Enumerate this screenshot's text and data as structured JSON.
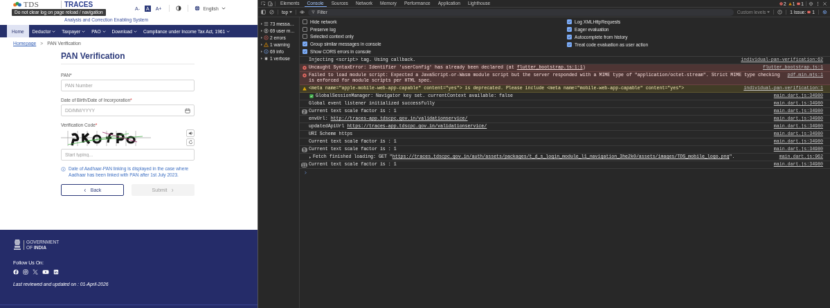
{
  "tooltip": "Do not clear log on page reload / navigation",
  "site": {
    "logo": "TDS",
    "brand": "TRACES",
    "tagline": "Analysis and Correction Enabling System",
    "font_controls": [
      {
        "label": "A-",
        "selected": false
      },
      {
        "label": "A",
        "selected": true
      },
      {
        "label": "A+",
        "selected": false
      }
    ],
    "language": "English"
  },
  "nav": [
    {
      "label": "Home",
      "selected": true,
      "dropdown": false
    },
    {
      "label": "Deductor",
      "selected": false,
      "dropdown": true
    },
    {
      "label": "Taxpayer",
      "selected": false,
      "dropdown": true
    },
    {
      "label": "PAO",
      "selected": false,
      "dropdown": true
    },
    {
      "label": "Download",
      "selected": false,
      "dropdown": true
    },
    {
      "label": "Compliance under Income Tax Act, 1961",
      "selected": false,
      "dropdown": true
    }
  ],
  "breadcrumb": {
    "link": "Homepage",
    "separator": ">",
    "current": "PAN Verification"
  },
  "form": {
    "title": "PAN Verification",
    "fields": [
      {
        "kind": "text",
        "label": "PAN*",
        "placeholder": "PAN Number"
      },
      {
        "kind": "date",
        "label": "Date of Birth/Date of Incorporation",
        "required": "*",
        "placeholder": "DD/MM/YYYY"
      },
      {
        "kind": "captcha",
        "label": "Verification Code",
        "required": "*",
        "placeholder": "Start typing..."
      }
    ],
    "note": "Date of Aadhaar-PAN linking is displayed in the case where Aadhaar has been linked with PAN after 1st July 2023.",
    "buttons": [
      {
        "kind": "back",
        "label": "Back",
        "disabled": false
      },
      {
        "kind": "submit",
        "label": "Submit",
        "disabled": true
      }
    ]
  },
  "footer": {
    "gov_line1": "GOVERNMENT",
    "gov_line2": "OF **INDIA**",
    "follow": "Follow Us  On:",
    "updated": "Last reviewed and updated on : 01-April-2026"
  },
  "devtools": {
    "tabs": [
      {
        "label": "Elements",
        "selected": false
      },
      {
        "label": "Console",
        "selected": true
      },
      {
        "label": "Sources",
        "selected": false
      },
      {
        "label": "Network",
        "selected": false
      },
      {
        "label": "Memory",
        "selected": false
      },
      {
        "label": "Performance",
        "selected": false
      },
      {
        "label": "Application",
        "selected": false
      },
      {
        "label": "Lighthouse",
        "selected": false
      }
    ],
    "counters": [
      {
        "kind": "error",
        "count": "2"
      },
      {
        "kind": "warning",
        "count": "1"
      },
      {
        "kind": "issue",
        "count": "1"
      }
    ],
    "context": "top",
    "filter_placeholder": "Filter",
    "levels": "Custom levels",
    "issues_label": "1 Issue:",
    "issues_count": "1",
    "sidebar": [
      {
        "kind": "messages",
        "label": "73 messa…",
        "selected": false
      },
      {
        "kind": "user",
        "label": "69 user m…",
        "selected": false
      },
      {
        "kind": "error",
        "label": "2 errors",
        "selected": false
      },
      {
        "kind": "warning",
        "label": "1 warning",
        "selected": false
      },
      {
        "kind": "info",
        "label": "69 info",
        "selected": false
      },
      {
        "kind": "verbose",
        "label": "1 verbose",
        "selected": false
      }
    ],
    "settings_left": [
      {
        "label": "Hide network",
        "checked": false
      },
      {
        "label": "Preserve log",
        "checked": false
      },
      {
        "label": "Selected context only",
        "checked": false
      },
      {
        "label": "Group similar messages in console",
        "checked": true
      },
      {
        "label": "Show CORS errors in console",
        "checked": true
      }
    ],
    "settings_right": [
      {
        "label": "Log XMLHttpRequests",
        "checked": true
      },
      {
        "label": "Eager evaluation",
        "checked": true
      },
      {
        "label": "Autocomplete from history",
        "checked": true
      },
      {
        "label": "Treat code evaluation as user action",
        "checked": true
      }
    ],
    "messages": [
      {
        "kind": "log",
        "parts": [
          {
            "text": "Injecting <script> tag. Using callback.",
            "link": false
          }
        ],
        "source": "individual-pan-verification:62"
      },
      {
        "kind": "error",
        "parts": [
          {
            "text": "Uncaught SyntaxError: Identifier 'userConfig' has already been declared (at ",
            "link": false
          },
          {
            "text": "flutter_bootstrap.js:1:1",
            "link": true
          },
          {
            "text": ")",
            "link": false
          }
        ],
        "source": "flutter_bootstrap.js:1"
      },
      {
        "kind": "error",
        "parts": [
          {
            "text": "Failed to load module script: Expected a JavaScript-or-Wasm module script but the server responded with a MIME type of \"application/octet-stream\". Strict MIME type checking is enforced for module scripts per HTML spec.",
            "link": false
          }
        ],
        "source": "pdf.min.mjs:1"
      },
      {
        "kind": "warning",
        "parts": [
          {
            "text": "<meta name=\"apple-mobile-web-app-capable\" content=\"yes\"> is deprecated. Please include <meta name=\"mobile-web-app-capable\" content=\"yes\">",
            "link": false
          }
        ],
        "source": "individual-pan-verification:1"
      },
      {
        "kind": "success",
        "parts": [
          {
            "text": "GlobalSessionManager: Navigator key set. currentContext available: false",
            "link": false
          }
        ],
        "source": "main.dart.js:34980"
      },
      {
        "kind": "log",
        "parts": [
          {
            "text": "Global event listener initialized successfully",
            "link": false
          }
        ],
        "source": "main.dart.js:34980"
      },
      {
        "kind": "log",
        "count": "2",
        "parts": [
          {
            "text": "Current text scale factor is : 1",
            "link": false
          }
        ],
        "source": "main.dart.js:34980"
      },
      {
        "kind": "log",
        "parts": [
          {
            "text": "envUrl: ",
            "link": false
          },
          {
            "text": "http://traces-app.tdscpc.gov.in/validationservice/",
            "link": true
          }
        ],
        "source": "main.dart.js:34980"
      },
      {
        "kind": "log",
        "parts": [
          {
            "text": "updatedApiUrl ",
            "link": false
          },
          {
            "text": "https://traces-app.tdscpc.gov.in/validationservice/",
            "link": true
          }
        ],
        "source": "main.dart.js:34980"
      },
      {
        "kind": "log",
        "parts": [
          {
            "text": "URI Scheme https",
            "link": false
          }
        ],
        "source": "main.dart.js:34980"
      },
      {
        "kind": "log",
        "parts": [
          {
            "text": "Current text scale factor is : 1",
            "link": false
          }
        ],
        "source": "main.dart.js:34980"
      },
      {
        "kind": "log",
        "count": "5",
        "parts": [
          {
            "text": "Current text scale factor is : 1",
            "link": false
          }
        ],
        "source": "main.dart.js:34980"
      },
      {
        "kind": "network",
        "parts": [
          {
            "text": "Fetch finished loading: GET \"",
            "link": false
          },
          {
            "text": "https://traces.tdscpc.gov.in/auth/assets/packages/t_d_s_login_module_l1_navigation_3he2k0/assets/images/TDS_mobile_logo.png",
            "link": true
          },
          {
            "text": "\".",
            "link": false
          }
        ],
        "source": "main.dart.js:962"
      },
      {
        "kind": "log",
        "count": "11",
        "parts": [
          {
            "text": "Current text scale factor is : 1",
            "link": false
          }
        ],
        "source": "main.dart.js:34980"
      }
    ]
  }
}
